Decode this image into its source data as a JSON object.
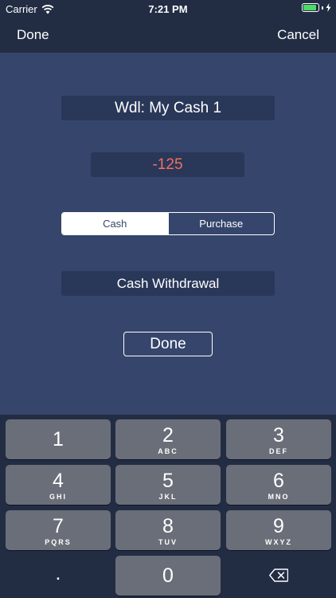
{
  "status_bar": {
    "carrier": "Carrier",
    "time": "7:21 PM",
    "battery_level_percent": 90
  },
  "nav": {
    "left_label": "Done",
    "right_label": "Cancel"
  },
  "form": {
    "title": "Wdl: My Cash 1",
    "amount": "-125",
    "amount_color": "#f0705e",
    "segments": [
      {
        "label": "Cash",
        "selected": true
      },
      {
        "label": "Purchase",
        "selected": false
      }
    ],
    "category": "Cash Withdrawal",
    "done_label": "Done"
  },
  "keypad": {
    "keys": [
      {
        "digit": "1",
        "letters": ""
      },
      {
        "digit": "2",
        "letters": "ABC"
      },
      {
        "digit": "3",
        "letters": "DEF"
      },
      {
        "digit": "4",
        "letters": "GHI"
      },
      {
        "digit": "5",
        "letters": "JKL"
      },
      {
        "digit": "6",
        "letters": "MNO"
      },
      {
        "digit": "7",
        "letters": "PQRS"
      },
      {
        "digit": "8",
        "letters": "TUV"
      },
      {
        "digit": "9",
        "letters": "WXYZ"
      }
    ],
    "decimal": ".",
    "zero": "0",
    "delete_icon": "backspace-icon"
  },
  "colors": {
    "background": "#35456c",
    "bar": "#222d44",
    "key": "#6a6e78",
    "battery": "#4cd964"
  }
}
